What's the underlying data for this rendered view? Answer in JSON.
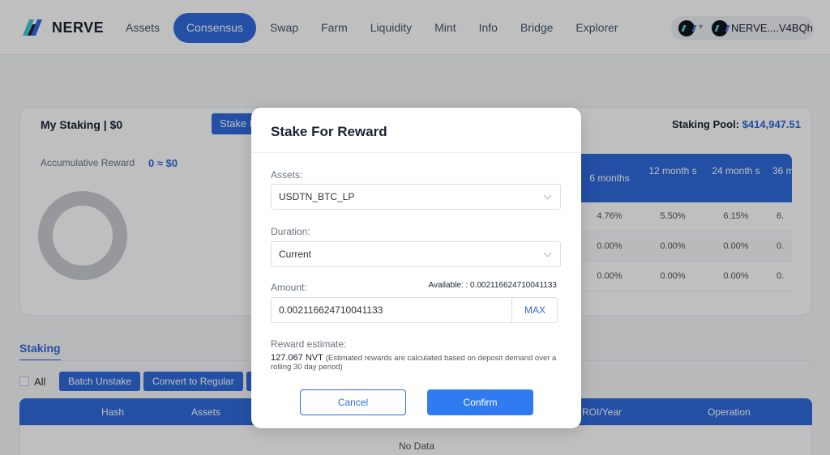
{
  "header": {
    "brand": "NERVE",
    "nav": [
      "Assets",
      "Consensus",
      "Swap",
      "Farm",
      "Liquidity",
      "Mint",
      "Info",
      "Bridge",
      "Explorer"
    ],
    "active_nav": "Consensus",
    "wallet_address": "NERVE....V4BQh"
  },
  "staking_summary": {
    "title": "My Staking | $0",
    "stake_button": "Stake F",
    "pool_label": "Staking Pool:",
    "pool_value": "$414,947.51",
    "accum_label": "Accumulative Reward",
    "accum_value": "0 ≈ $0"
  },
  "rate_table": {
    "headers": [
      "6 months",
      "12 month s",
      "24 month s",
      "36 m"
    ],
    "rows": [
      [
        "4.76%",
        "5.50%",
        "6.15%",
        "6."
      ],
      [
        "0.00%",
        "0.00%",
        "0.00%",
        "0."
      ],
      [
        "0.00%",
        "0.00%",
        "0.00%",
        "0."
      ]
    ]
  },
  "staking_list": {
    "tab": "Staking",
    "all_label": "All",
    "batch_unstake": "Batch Unstake",
    "convert_regular": "Convert to Regular",
    "columns": [
      "Hash",
      "Assets",
      "ROI/Year",
      "Operation"
    ],
    "empty": "No Data"
  },
  "modal": {
    "title": "Stake For Reward",
    "assets_label": "Assets:",
    "assets_value": "USDTN_BTC_LP",
    "duration_label": "Duration:",
    "duration_value": "Current",
    "amount_label": "Amount:",
    "available": "Available: : 0.002116624710041133",
    "amount_value": "0.002116624710041133",
    "max": "MAX",
    "reward_label": "Reward estimate:",
    "reward_value": "127.067 NVT",
    "reward_note": "(Estimated rewards are calculated based on deposit demand over a rolling 30 day period)",
    "cancel": "Cancel",
    "confirm": "Confirm"
  }
}
